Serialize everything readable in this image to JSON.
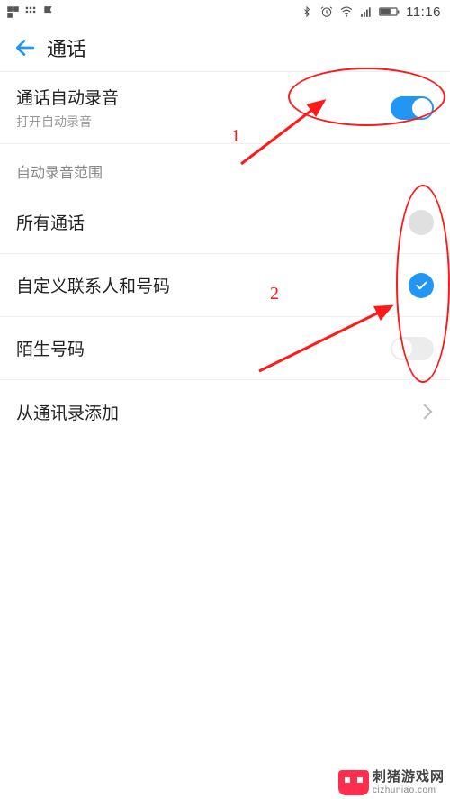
{
  "status": {
    "time": "11:16"
  },
  "header": {
    "title": "通话"
  },
  "auto_record": {
    "title": "通话自动录音",
    "subtitle": "打开自动录音",
    "enabled": true
  },
  "section": {
    "scope_label": "自动录音范围"
  },
  "scope": {
    "all_calls": {
      "label": "所有通话",
      "selected": false
    },
    "custom_contacts": {
      "label": "自定义联系人和号码",
      "selected": true
    },
    "unknown_numbers": {
      "label": "陌生号码",
      "enabled": false
    }
  },
  "add_from_contacts": {
    "label": "从通讯录添加"
  },
  "annotations": {
    "label1": "1",
    "label2": "2"
  },
  "watermark": {
    "cn": "刺猪游戏网",
    "en": "cizhuniao.com"
  }
}
